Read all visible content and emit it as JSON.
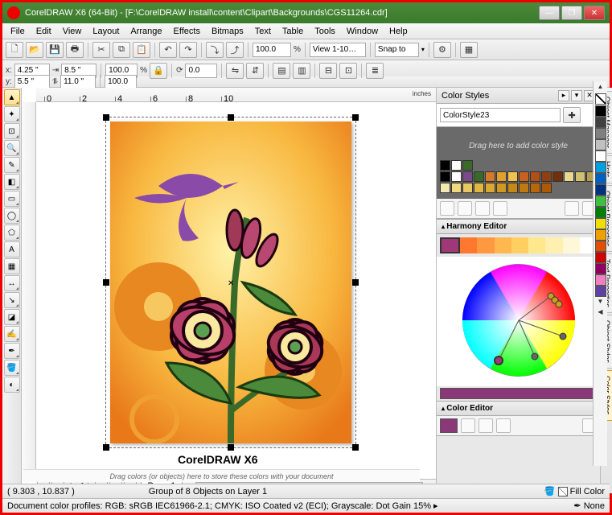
{
  "window": {
    "title": "CorelDRAW X6 (64-Bit) - [F:\\CorelDRAW install\\content\\Clipart\\Backgrounds\\CGS11264.cdr]"
  },
  "menu": [
    "File",
    "Edit",
    "View",
    "Layout",
    "Arrange",
    "Effects",
    "Bitmaps",
    "Text",
    "Table",
    "Tools",
    "Window",
    "Help"
  ],
  "toolbar": {
    "zoom_pct": "100.0",
    "view_label": "View 1-10…",
    "snap_label": "Snap to"
  },
  "propbar": {
    "x_label": "x:",
    "x_val": "4.25 \"",
    "y_label": "y:",
    "y_val": "5.5 \"",
    "w_val": "8.5 \"",
    "h_val": "11.0 \"",
    "scale_x": "100.0",
    "scale_y": "100.0",
    "rot_val": "0.0",
    "pct": "%"
  },
  "ruler": {
    "units": "inches",
    "h_ticks": [
      "0",
      "2",
      "4",
      "6",
      "8",
      "10"
    ]
  },
  "paging": {
    "page_of": "1 of 1",
    "tab": "Page 1"
  },
  "panel": {
    "title": "Color Styles",
    "style_name": "ColorStyle23",
    "drop_hint": "Drag here to add color style",
    "harmony_title": "Harmony Editor",
    "color_editor_title": "Color Editor"
  },
  "right_tabs": [
    "Object Manager",
    "Hints",
    "Object Properties",
    "Text Properties",
    "Object Styles",
    "Color Styles"
  ],
  "swatches_row1": [
    "#000000",
    "#ffffff",
    "#3a6a2a"
  ],
  "swatches_row2": [
    "#000000",
    "#ffffff",
    "#7a4a8a",
    "#3a6a2a",
    "#d47a2a",
    "#e0a030",
    "#f0c050",
    "#c86020",
    "#b05018",
    "#904010",
    "#703008",
    "#e8d890",
    "#d0c070",
    "#b0a050"
  ],
  "swatches_row3": [
    "#f4e8b0",
    "#f0d880",
    "#e8c860",
    "#e0b840",
    "#d8a830",
    "#d09820",
    "#c88818",
    "#c07810",
    "#b86808",
    "#b05800"
  ],
  "harmony_colors": [
    "#a03878",
    "#ff7830",
    "#ff9840",
    "#ffb850",
    "#ffd060",
    "#ffe88c",
    "#fff0b0",
    "#fff8d8",
    "#ffffff"
  ],
  "palette_colors": [
    "#000000",
    "#404040",
    "#808080",
    "#c0c0c0",
    "#ffffff",
    "#00a0e0",
    "#0060c0",
    "#003080",
    "#40c040",
    "#008000",
    "#f0e000",
    "#f0a000",
    "#e05000",
    "#d00000",
    "#900060",
    "#f080c0",
    "#6040a0"
  ],
  "watermark": "CorelDRAW X6",
  "hint_text": "Drag colors (or objects) here to store these colors with your document",
  "status": {
    "coords": "( 9.303 , 10.837 )",
    "selection": "Group of 8 Objects on Layer 1",
    "fill_label": "Fill Color",
    "outline_label": "None",
    "profiles": "Document color profiles: RGB: sRGB IEC61966-2.1; CMYK: ISO Coated v2 (ECI); Grayscale: Dot Gain 15%  ▸"
  }
}
